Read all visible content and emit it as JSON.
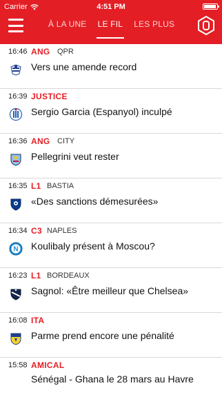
{
  "status_bar": {
    "carrier": "Carrier",
    "time": "4:51 PM"
  },
  "nav": {
    "tabs": [
      {
        "label": "À LA UNE",
        "active": false
      },
      {
        "label": "LE FIL",
        "active": true
      },
      {
        "label": "LES PLUS",
        "active": false
      }
    ],
    "logo_icon": "hexagon-zero-icon",
    "menu_icon": "hamburger-icon"
  },
  "colors": {
    "brand": "#e41e25"
  },
  "feed": [
    {
      "time": "16:46",
      "category": "ANG",
      "subcategory": "QPR",
      "icon": "qpr-crest-icon",
      "headline": "Vers une amende record"
    },
    {
      "time": "16:39",
      "category": "JUSTICE",
      "subcategory": "",
      "icon": "espanyol-crest-icon",
      "headline": "Sergio Garcia (Espanyol) inculpé"
    },
    {
      "time": "16:36",
      "category": "ANG",
      "subcategory": "CITY",
      "icon": "man-city-crest-icon",
      "headline": "Pellegrini veut rester"
    },
    {
      "time": "16:35",
      "category": "L1",
      "subcategory": "BASTIA",
      "icon": "bastia-crest-icon",
      "headline": "«Des sanctions démesurées»"
    },
    {
      "time": "16:34",
      "category": "C3",
      "subcategory": "NAPLES",
      "icon": "napoli-crest-icon",
      "headline": "Koulibaly présent à Moscou?"
    },
    {
      "time": "16:23",
      "category": "L1",
      "subcategory": "BORDEAUX",
      "icon": "bordeaux-crest-icon",
      "headline": "Sagnol: «Être meilleur que Chelsea»"
    },
    {
      "time": "16:08",
      "category": "ITA",
      "subcategory": "",
      "icon": "parma-crest-icon",
      "headline": "Parme prend encore une pénalité"
    },
    {
      "time": "15:58",
      "category": "AMICAL",
      "subcategory": "",
      "icon": "",
      "headline": "Sénégal - Ghana le 28 mars au Havre"
    }
  ]
}
